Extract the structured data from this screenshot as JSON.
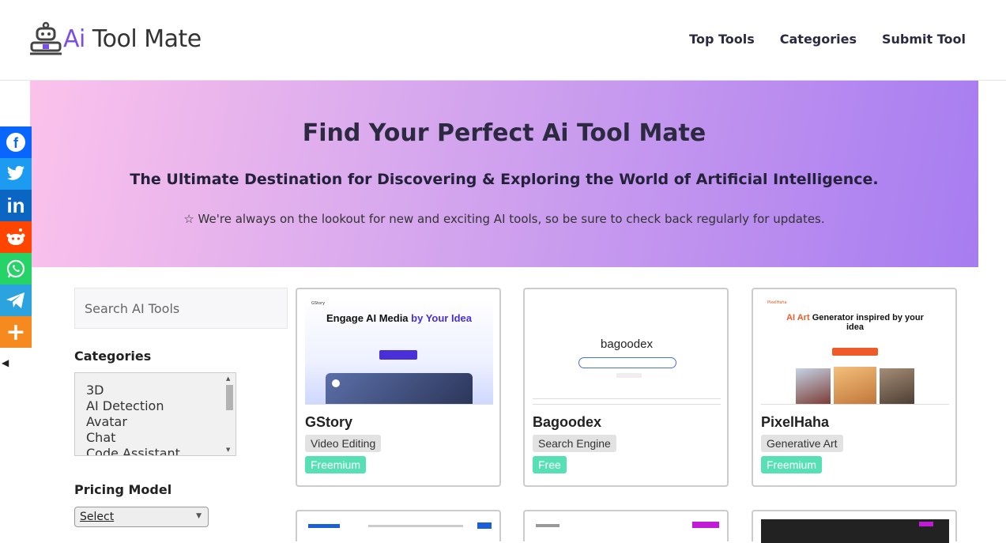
{
  "header": {
    "logo_ai": "Ai",
    "logo_rest": " Tool Mate",
    "nav": [
      "Top Tools",
      "Categories",
      "Submit Tool"
    ]
  },
  "hero": {
    "title": "Find Your Perfect Ai Tool Mate",
    "subtitle": "The Ultimate Destination for Discovering & Exploring the World of Artificial Intelligence.",
    "note": "☆ We're always on the lookout for new and exciting AI tools, so be sure to check back regularly for updates."
  },
  "share": [
    {
      "name": "facebook",
      "glyph": "f",
      "color": "#0866ff"
    },
    {
      "name": "twitter",
      "glyph": "🐦",
      "color": "#1d9bf0"
    },
    {
      "name": "linkedin",
      "glyph": "in",
      "color": "#0a66c2"
    },
    {
      "name": "reddit",
      "glyph": "●",
      "color": "#ff4500"
    },
    {
      "name": "whatsapp",
      "glyph": "✆",
      "color": "#25d366"
    },
    {
      "name": "telegram",
      "glyph": "➤",
      "color": "#2aa3df"
    },
    {
      "name": "more",
      "glyph": "+",
      "color": "#f68a1e"
    }
  ],
  "sidebar": {
    "search_placeholder": "Search AI Tools",
    "categories_title": "Categories",
    "categories": [
      "3D",
      "AI Detection",
      "Avatar",
      "Chat",
      "Code Assistant"
    ],
    "pricing_title": "Pricing Model",
    "pricing_select": "Select"
  },
  "tools": [
    {
      "name": "GStory",
      "category": "Video Editing",
      "pricing": "Freemium",
      "shot_headline": "Engage AI Media ",
      "shot_headline_accent": "by Your Idea",
      "shot_brand": "GStory"
    },
    {
      "name": "Bagoodex",
      "category": "Search Engine",
      "pricing": "Free",
      "shot_headline": "bagoodex",
      "shot_headline_accent": "",
      "shot_brand": "bagoodex"
    },
    {
      "name": "PixelHaha",
      "category": "Generative Art",
      "pricing": "Freemium",
      "shot_headline": "AI Art ",
      "shot_headline_accent": "Generator inspired by your idea",
      "shot_brand": "PixelHaha"
    }
  ],
  "colors": {
    "accent": "#7b4ee8",
    "price_badge": "#57e0b4"
  }
}
